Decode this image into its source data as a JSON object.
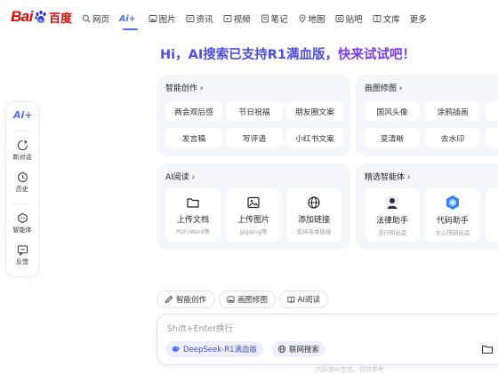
{
  "header": {
    "logo_text": "Bai",
    "logo_cn": "百度",
    "nav": [
      {
        "label": "网页",
        "icon": "search-icon"
      },
      {
        "label": "Ai+",
        "icon": "ai-icon",
        "active": true
      },
      {
        "label": "图片",
        "icon": "image-icon"
      },
      {
        "label": "资讯",
        "icon": "news-icon"
      },
      {
        "label": "视频",
        "icon": "video-icon"
      },
      {
        "label": "笔记",
        "icon": "note-icon"
      },
      {
        "label": "地图",
        "icon": "map-icon"
      },
      {
        "label": "贴吧",
        "icon": "tieba-icon"
      },
      {
        "label": "文库",
        "icon": "library-icon"
      },
      {
        "label": "更多",
        "icon": ""
      }
    ]
  },
  "headline": {
    "part1": "Hi，AI搜索已支持R1满血版，",
    "part2": "快来试试吧！"
  },
  "sidebar": {
    "ai_label": "Ai+",
    "items": [
      {
        "label": "新对话",
        "icon": "new-chat-icon"
      },
      {
        "label": "历史",
        "icon": "history-icon"
      },
      {
        "label": "智能体",
        "icon": "agent-icon"
      },
      {
        "label": "反馈",
        "icon": "feedback-icon"
      }
    ]
  },
  "cards": {
    "writing": {
      "title": "智能创作 ›",
      "chips": [
        "两会观后感",
        "节日祝福",
        "朋友圈文案",
        "发言稿",
        "写评语",
        "小红书文案"
      ]
    },
    "image_edit": {
      "title": "画图修图 ›",
      "chips": [
        "国风头像",
        "涂鸦插画",
        "变清晰",
        "去水印"
      ]
    },
    "ai_read": {
      "title": "AI阅读 ›",
      "tiles": [
        {
          "label": "上传文档",
          "sub": "PDF/Word等",
          "icon": "folder-icon"
        },
        {
          "label": "上传图片",
          "sub": "jpg/png等",
          "icon": "picture-icon"
        },
        {
          "label": "添加链接",
          "sub": "支持各类链接",
          "icon": "globe-icon"
        }
      ]
    },
    "agents": {
      "title": "精选智能体 ›",
      "tiles": [
        {
          "label": "法律助手",
          "sub": "法行知出品",
          "icon": "lawyer-avatar-icon"
        },
        {
          "label": "代码助手",
          "sub": "文心快码出品",
          "icon": "code-assistant-icon"
        }
      ]
    }
  },
  "quick_pills": [
    {
      "label": "智能创作",
      "icon": "pen-icon"
    },
    {
      "label": "画图修图",
      "icon": "image-icon"
    },
    {
      "label": "AI阅读",
      "icon": "book-icon"
    }
  ],
  "input": {
    "placeholder": "Shift+Enter换行",
    "modes": [
      {
        "label": "DeepSeek-R1满血版",
        "icon": "deepseek-icon"
      },
      {
        "label": "联网搜索",
        "icon": "globe-icon"
      }
    ]
  },
  "footer": "内容由AI生成，仅供参考",
  "colors": {
    "brand_red": "#e10602",
    "accent_blue": "#4e6ef2",
    "headline_purple": "#7a3ef0"
  }
}
